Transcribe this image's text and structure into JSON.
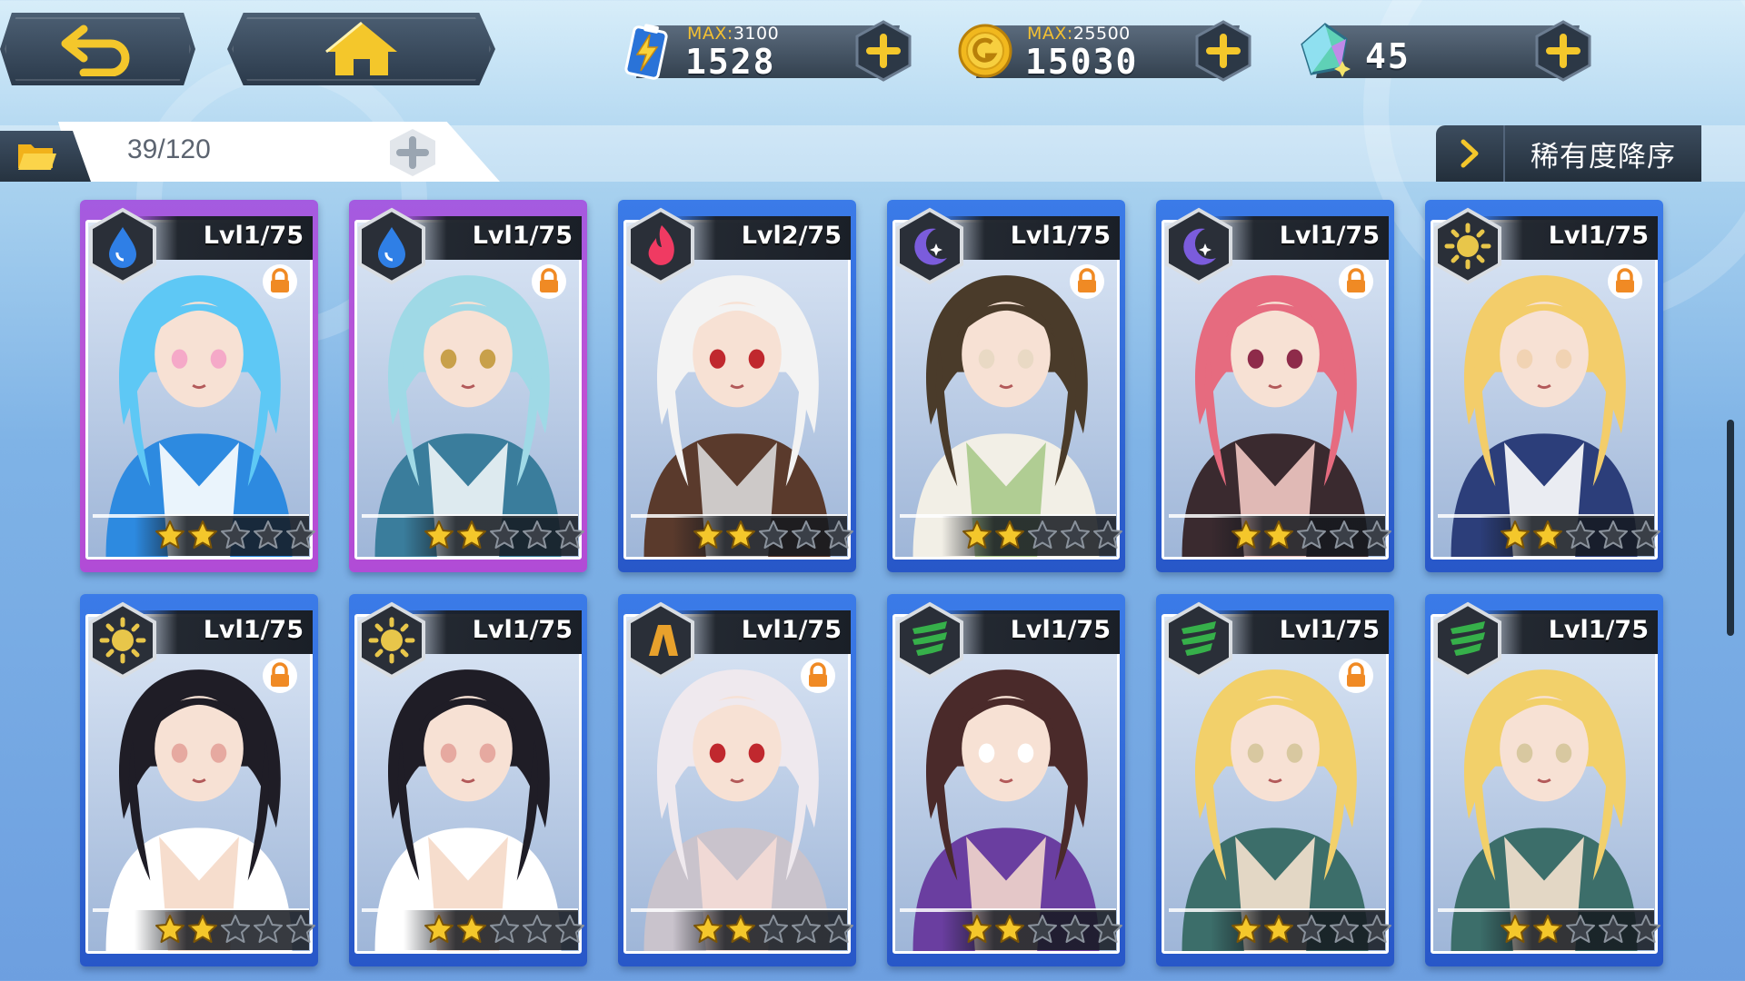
{
  "resources": [
    {
      "name": "energy",
      "max_label": "MAX:",
      "max_value": "3100",
      "value": "1528",
      "icon": "battery-bolt-icon"
    },
    {
      "name": "gold",
      "max_label": "MAX:",
      "max_value": "25500",
      "value": "15030",
      "icon": "gold-coin-icon"
    },
    {
      "name": "crystal",
      "value": "45",
      "icon": "crystal-gem-icon"
    }
  ],
  "inventory": {
    "count": "39/120"
  },
  "sort": {
    "label": "稀有度降序"
  },
  "colors": {
    "water": "#2f7fe6",
    "fire": "#f03a62",
    "moon": "#7b5cdc",
    "sun": "#e8c64a",
    "earth": "#e8a12c",
    "wind": "#36b04a",
    "star_on": "#f4c72b",
    "star_off": "#3a3f47",
    "purple_frame": "#b04cd6",
    "blue_frame": "#2f62d6"
  },
  "cards": [
    {
      "level": "Lvl1/75",
      "element": "water",
      "frame": "purple",
      "locked": true,
      "stars": 2,
      "palette": [
        "#5ec8f5",
        "#2d8ae0",
        "#ffffff",
        "#f5a9c8"
      ]
    },
    {
      "level": "Lvl1/75",
      "element": "water",
      "frame": "purple",
      "locked": true,
      "stars": 2,
      "palette": [
        "#9fd9e6",
        "#3a7d9c",
        "#f0f6f8",
        "#c8a04a"
      ]
    },
    {
      "level": "Lvl2/75",
      "element": "fire",
      "frame": "blue",
      "locked": false,
      "stars": 2,
      "palette": [
        "#f3f3f3",
        "#5a3a2c",
        "#d9d9d9",
        "#c0282e"
      ]
    },
    {
      "level": "Lvl1/75",
      "element": "moon",
      "frame": "blue",
      "locked": true,
      "stars": 2,
      "palette": [
        "#4a3b2a",
        "#f2efe6",
        "#a9c98a",
        "#e9d9c4"
      ]
    },
    {
      "level": "Lvl1/75",
      "element": "moon",
      "frame": "blue",
      "locked": true,
      "stars": 2,
      "palette": [
        "#e66b7f",
        "#3a2a2f",
        "#f3c9c4",
        "#8e2b4a"
      ]
    },
    {
      "level": "Lvl1/75",
      "element": "sun",
      "frame": "blue",
      "locked": true,
      "stars": 2,
      "palette": [
        "#f3cd6a",
        "#2c3e7a",
        "#ffffff",
        "#f1d3b3"
      ]
    },
    {
      "level": "Lvl1/75",
      "element": "sun",
      "frame": "blue",
      "locked": true,
      "stars": 2,
      "palette": [
        "#1f1d26",
        "#ffffff",
        "#f5d9c8",
        "#e6a9a0"
      ]
    },
    {
      "level": "Lvl1/75",
      "element": "sun",
      "frame": "blue",
      "locked": false,
      "stars": 2,
      "palette": [
        "#1f1d26",
        "#ffffff",
        "#f5d9c8",
        "#e6a9a0"
      ]
    },
    {
      "level": "Lvl1/75",
      "element": "earth",
      "frame": "blue",
      "locked": true,
      "stars": 2,
      "palette": [
        "#efe9ee",
        "#c9c3cc",
        "#f4dcd6",
        "#c0282e"
      ]
    },
    {
      "level": "Lvl1/75",
      "element": "wind",
      "frame": "blue",
      "locked": false,
      "stars": 2,
      "palette": [
        "#4a2a2a",
        "#6a3ea0",
        "#f2d6cc",
        "#ffffff"
      ]
    },
    {
      "level": "Lvl1/75",
      "element": "wind",
      "frame": "blue",
      "locked": true,
      "stars": 2,
      "palette": [
        "#f2d06a",
        "#3c6e6a",
        "#f5e2cf",
        "#d8c8a0"
      ]
    },
    {
      "level": "Lvl1/75",
      "element": "wind",
      "frame": "blue",
      "locked": false,
      "stars": 2,
      "palette": [
        "#f2d06a",
        "#3c6e6a",
        "#f5e2cf",
        "#d8c8a0"
      ]
    }
  ]
}
